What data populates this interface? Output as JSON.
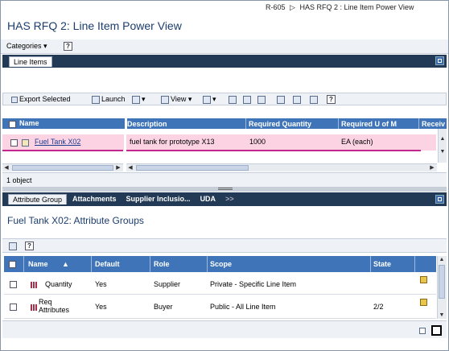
{
  "breadcrumb": {
    "items": [
      "R-605",
      "HAS RFQ 2 : Line Item Power View"
    ]
  },
  "page": {
    "title": "HAS RFQ 2: Line Item Power View"
  },
  "toolbar1": {
    "categories_label": "Categories",
    "help_label": "?"
  },
  "line_items_panel": {
    "tab_label": "Line Items",
    "toolbar": {
      "export_label": "Export Selected",
      "launch_label": "Launch",
      "view_label": "View"
    },
    "columns": [
      "Name",
      "Description",
      "Required Quantity",
      "Required U of M",
      "Receiv"
    ],
    "rows": [
      {
        "name": "Fuel Tank X02",
        "description": "fuel tank for prototype X13",
        "quantity": "1000",
        "uom": "EA (each)"
      }
    ],
    "status_text": "1 object"
  },
  "attributes_panel": {
    "tabs": [
      "Attribute Group",
      "Attachments",
      "Supplier Inclusio...",
      "UDA"
    ],
    "overflow_label": ">>",
    "title": "Fuel Tank X02: Attribute Groups",
    "columns": [
      "Name",
      "Default",
      "Role",
      "Scope",
      "State"
    ],
    "rows": [
      {
        "name": "Quantity",
        "default": "Yes",
        "role": "Supplier",
        "scope": "Private - Specific Line Item",
        "state": ""
      },
      {
        "name_line1": "Req",
        "name_line2": "Attributes",
        "default": "Yes",
        "role": "Buyer",
        "scope": "Public - All Line Item",
        "state": "2/2"
      }
    ]
  },
  "colors": {
    "accent": "#3f75b8",
    "dark_bar": "#223a55",
    "selection": "#fbd3e3",
    "highlight_border": "#c2288e"
  }
}
